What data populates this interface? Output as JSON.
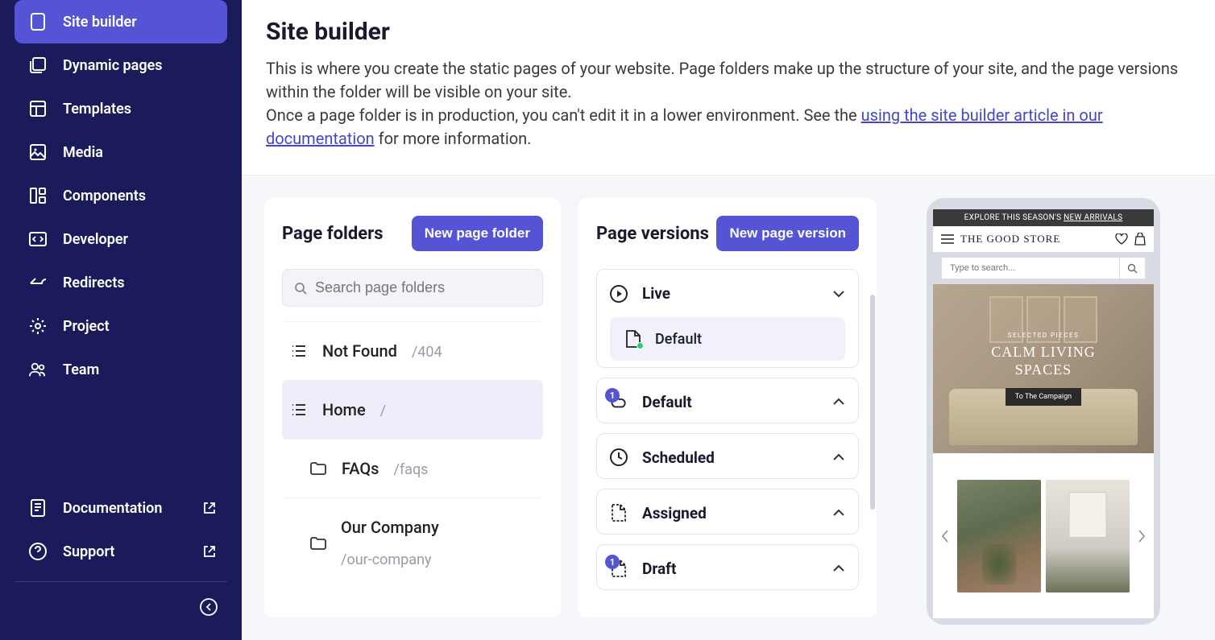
{
  "sidebar": {
    "items": [
      {
        "label": "Site builder"
      },
      {
        "label": "Dynamic pages"
      },
      {
        "label": "Templates"
      },
      {
        "label": "Media"
      },
      {
        "label": "Components"
      },
      {
        "label": "Developer"
      },
      {
        "label": "Redirects"
      },
      {
        "label": "Project"
      },
      {
        "label": "Team"
      }
    ],
    "bottom": [
      {
        "label": "Documentation"
      },
      {
        "label": "Support"
      }
    ]
  },
  "header": {
    "title": "Site builder",
    "desc1": "This is where you create the static pages of your website. Page folders make up the structure of your site, and the page versions within the folder will be visible on your site.",
    "desc2a": "Once a page folder is in production, you can't edit it in a lower environment. See the ",
    "desc2link": "using the site builder article in our documentation",
    "desc2b": " for more information."
  },
  "folders": {
    "title": "Page folders",
    "newBtn": "New page folder",
    "searchPlaceholder": "Search page folders",
    "items": [
      {
        "name": "Not Found",
        "path": "/404"
      },
      {
        "name": "Home",
        "path": "/"
      },
      {
        "name": "FAQs",
        "path": "/faqs"
      },
      {
        "name": "Our Company",
        "path": "/our-company"
      }
    ]
  },
  "versions": {
    "title": "Page versions",
    "newBtn": "New page version",
    "groups": {
      "live": {
        "label": "Live",
        "sub": "Default"
      },
      "default": {
        "label": "Default",
        "badge": "1"
      },
      "scheduled": {
        "label": "Scheduled"
      },
      "assigned": {
        "label": "Assigned"
      },
      "draft": {
        "label": "Draft",
        "badge": "1"
      }
    }
  },
  "preview": {
    "banner1": "EXPLORE THIS SEASON'S ",
    "banner2": "NEW ARRIVALS",
    "brand": "THE GOOD STORE",
    "searchPlaceholder": "Type to search...",
    "heroSub": "SELECTED PIECES",
    "heroTitle1": "CALM LIVING",
    "heroTitle2": "SPACES",
    "heroBtn": "To The Campaign"
  }
}
